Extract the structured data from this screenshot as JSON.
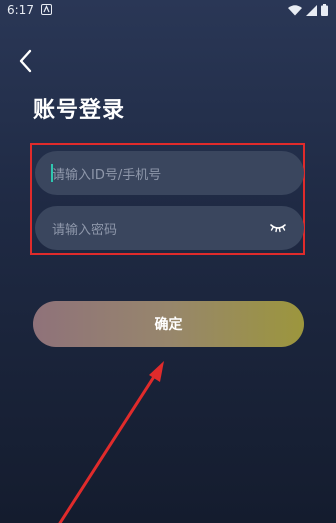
{
  "status_bar": {
    "time": "6:17"
  },
  "header": {
    "title": "账号登录"
  },
  "form": {
    "id_placeholder": "请输入ID号/手机号",
    "password_placeholder": "请输入密码"
  },
  "actions": {
    "confirm_label": "确定"
  },
  "annotation": {
    "color": "#e02b2b"
  },
  "theme": {
    "background_top": "#2a3756",
    "background_bottom": "#141c2e",
    "input_background": "#3a465e",
    "button_gradient": [
      "#8f727a",
      "#9c963d"
    ],
    "caret_color": "#2ec7b0"
  }
}
